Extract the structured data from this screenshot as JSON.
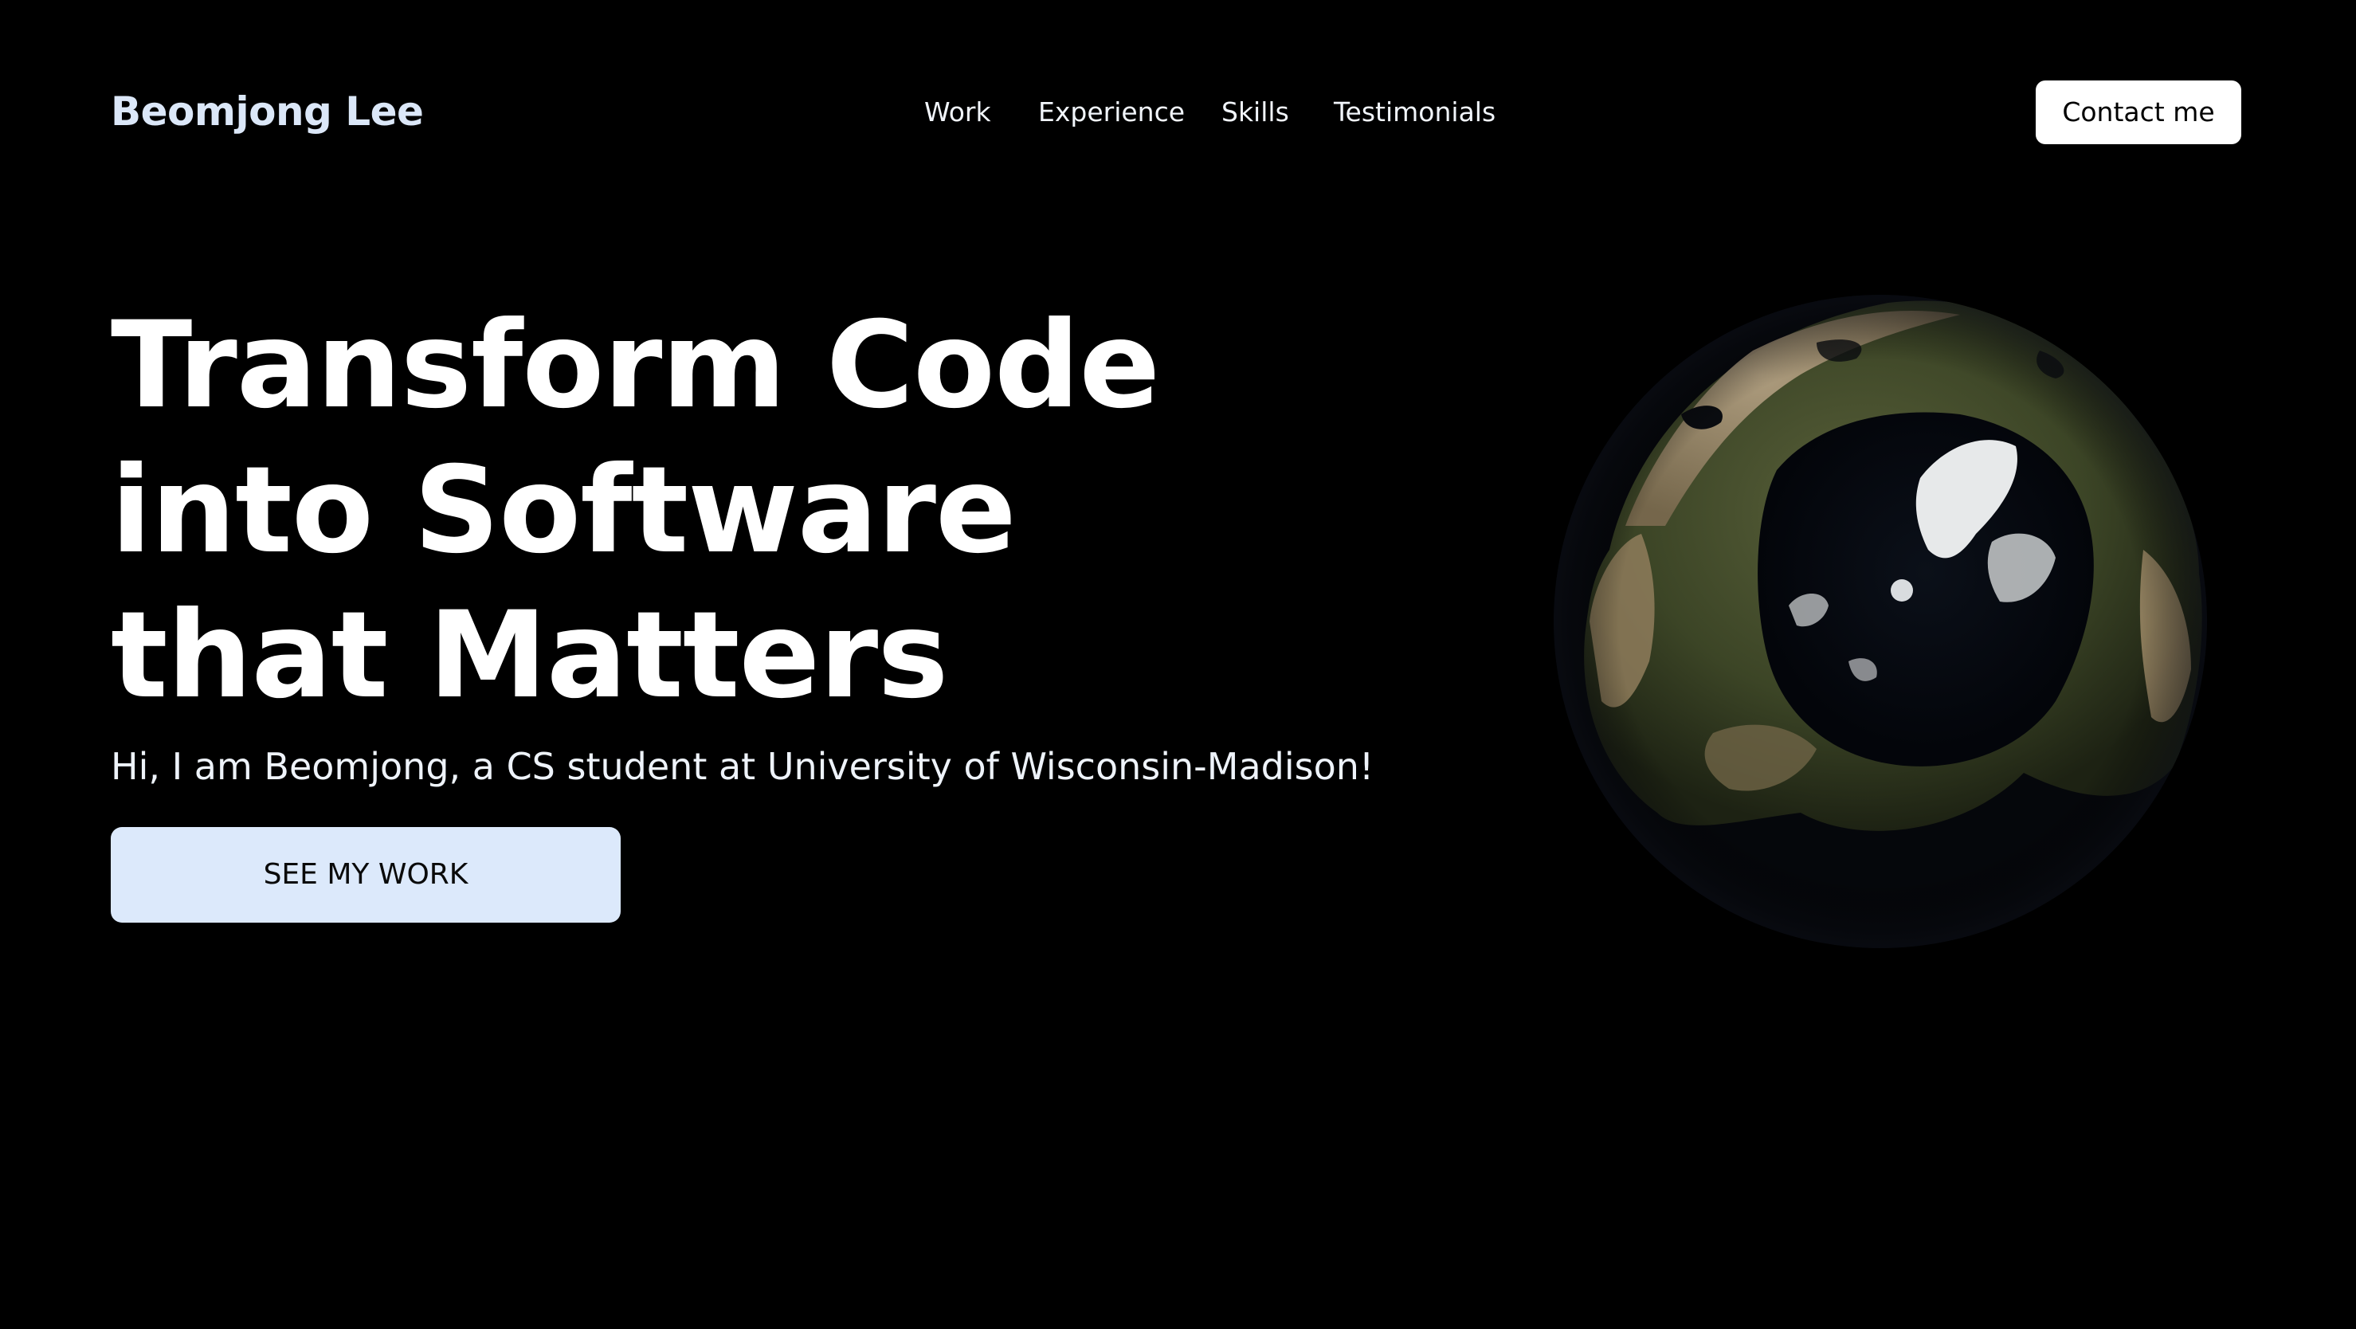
{
  "header": {
    "brand": "Beomjong Lee",
    "nav": [
      {
        "label": "Work"
      },
      {
        "label": "Experience"
      },
      {
        "label": "Skills"
      },
      {
        "label": "Testimonials"
      }
    ],
    "contact_label": "Contact me"
  },
  "hero": {
    "headline_lines": [
      "Transform Code",
      "into Software",
      "that Matters"
    ],
    "subtitle": "Hi, I am Beomjong, a CS student at University of Wisconsin-Madison!",
    "cta_label": "SEE MY WORK"
  },
  "colors": {
    "background": "#000000",
    "brand_text": "#dbe7f8",
    "cta_background": "#dce9fb",
    "contact_background": "#ffffff"
  },
  "icons": {
    "globe": "earth-globe-icon"
  }
}
